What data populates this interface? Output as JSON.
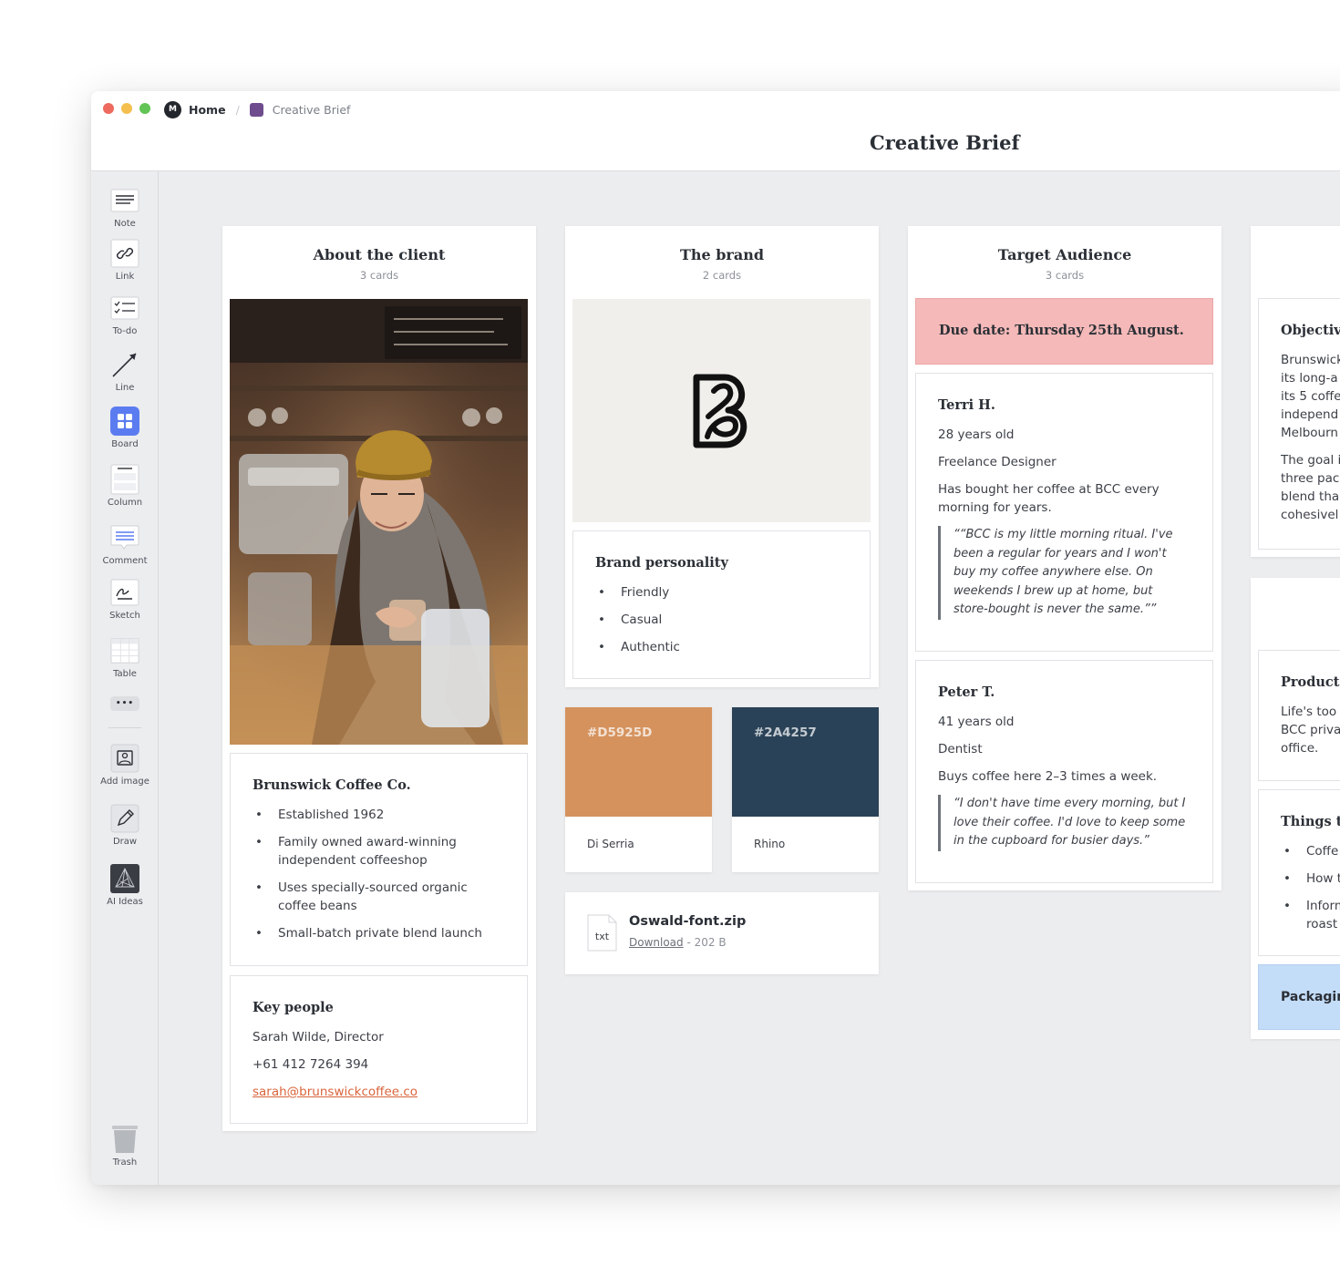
{
  "breadcrumb": {
    "home_logo": "M",
    "home": "Home",
    "separator": "/",
    "board": "Creative Brief"
  },
  "page_title": "Creative Brief",
  "toolbar": {
    "items": [
      {
        "label": "Note",
        "icon": "note-icon"
      },
      {
        "label": "Link",
        "icon": "link-icon"
      },
      {
        "label": "To-do",
        "icon": "todo-icon"
      },
      {
        "label": "Line",
        "icon": "line-icon"
      },
      {
        "label": "Board",
        "icon": "board-icon"
      },
      {
        "label": "Column",
        "icon": "column-icon"
      },
      {
        "label": "Comment",
        "icon": "comment-icon"
      },
      {
        "label": "Sketch",
        "icon": "sketch-icon"
      },
      {
        "label": "Table",
        "icon": "table-icon"
      },
      {
        "label": "Add image",
        "icon": "add-image-icon"
      },
      {
        "label": "Draw",
        "icon": "draw-icon"
      },
      {
        "label": "AI Ideas",
        "icon": "ai-ideas-icon"
      }
    ],
    "more": "•••",
    "trash": "Trash"
  },
  "columns": {
    "client": {
      "title": "About the client",
      "count": "3 cards",
      "company_card": {
        "title": "Brunswick Coffee Co.",
        "bullets": [
          "Established 1962",
          "Family owned award-winning independent coffeeshop",
          "Uses specially-sourced organic coffee beans",
          "Small-batch private blend launch"
        ]
      },
      "people_card": {
        "title": "Key people",
        "name": "Sarah Wilde, Director",
        "phone": "+61 412 7264 394",
        "email": "sarah@brunswickcoffee.co"
      }
    },
    "brand": {
      "title": "The brand",
      "count": "2 cards",
      "personality_card": {
        "title": "Brand personality",
        "bullets": [
          "Friendly",
          "Casual",
          "Authentic"
        ]
      },
      "swatches": [
        {
          "hex": "#D5925D",
          "name": "Di Serria",
          "color": "#D5925D"
        },
        {
          "hex": "#2A4257",
          "name": "Rhino",
          "color": "#2A4257"
        }
      ],
      "file": {
        "ext": "txt",
        "name": "Oswald-font.zip",
        "download": "Download",
        "size": "- 202 B"
      }
    },
    "audience": {
      "title": "Target Audience",
      "count": "3 cards",
      "due": "Due date: Thursday 25th August.",
      "persona1": {
        "name": "Terri H.",
        "age": "28 years old",
        "job": "Freelance Designer",
        "habit": "Has bought her coffee at BCC every morning for years.",
        "quote": "““BCC is my little morning ritual. I've been a regular for years and I won't buy my coffee anywhere else. On weekends I brew up at home, but store-bought is never the same.””"
      },
      "persona2": {
        "name": "Peter T.",
        "age": "41 years old",
        "job": "Dentist",
        "habit": "Buys coffee here 2–3 times a week.",
        "quote": "“I don't have time every morning, but I love their coffee. I'd love to keep some in the cupboard for busier days.”"
      }
    },
    "partial": {
      "objective": {
        "title": "Objective",
        "para1": [
          "Brunswick",
          "its long-a",
          "its 5 coffe",
          "independ",
          "Melbourn"
        ],
        "para2": [
          "The goal i",
          "three pac",
          "blend tha",
          "cohesivel"
        ]
      },
      "product": {
        "title": "Product ",
        "lines": [
          "Life's too",
          "BCC priva",
          "office."
        ]
      },
      "things": {
        "title": "Things to",
        "bullets": [
          [
            "Coffe"
          ],
          [
            "How t"
          ],
          [
            "Inform",
            "roast"
          ]
        ]
      },
      "packaging": "Packagin"
    }
  },
  "colors": {
    "accent": "#D9643C",
    "due_bg": "#F4B9B8",
    "packaging_bg": "#C3DCF8",
    "board_icon": "#5B7CF0",
    "board_swatch": "#6E4C8E"
  }
}
